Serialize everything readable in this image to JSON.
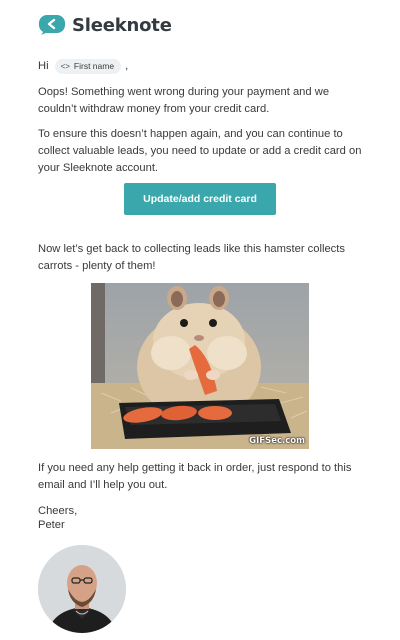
{
  "logo": {
    "text": "Sleeknote",
    "brand_color": "#3aa7ad"
  },
  "greeting": {
    "prefix": "Hi",
    "merge_tag": "First name",
    "merge_tag_icon": "code-icon",
    "suffix": ","
  },
  "paragraphs": {
    "p1": "Oops! Something went wrong during your payment and we couldn’t withdraw money from your credit card.",
    "p2": "To ensure this doesn’t happen again, and you can continue to collect valuable leads, you need to update or add a credit card on your Sleeknote account.",
    "p3": "Now let’s get back to collecting leads like this hamster collects carrots - plenty of them!",
    "p4": "If you need any help getting it back in order, just respond to this email and I’ll help you out."
  },
  "cta": {
    "label": "Update/add credit card",
    "color": "#3aa7ad"
  },
  "gif": {
    "watermark": "GIFSec.com"
  },
  "signoff": {
    "line1": "Cheers,",
    "line2": "Peter"
  }
}
